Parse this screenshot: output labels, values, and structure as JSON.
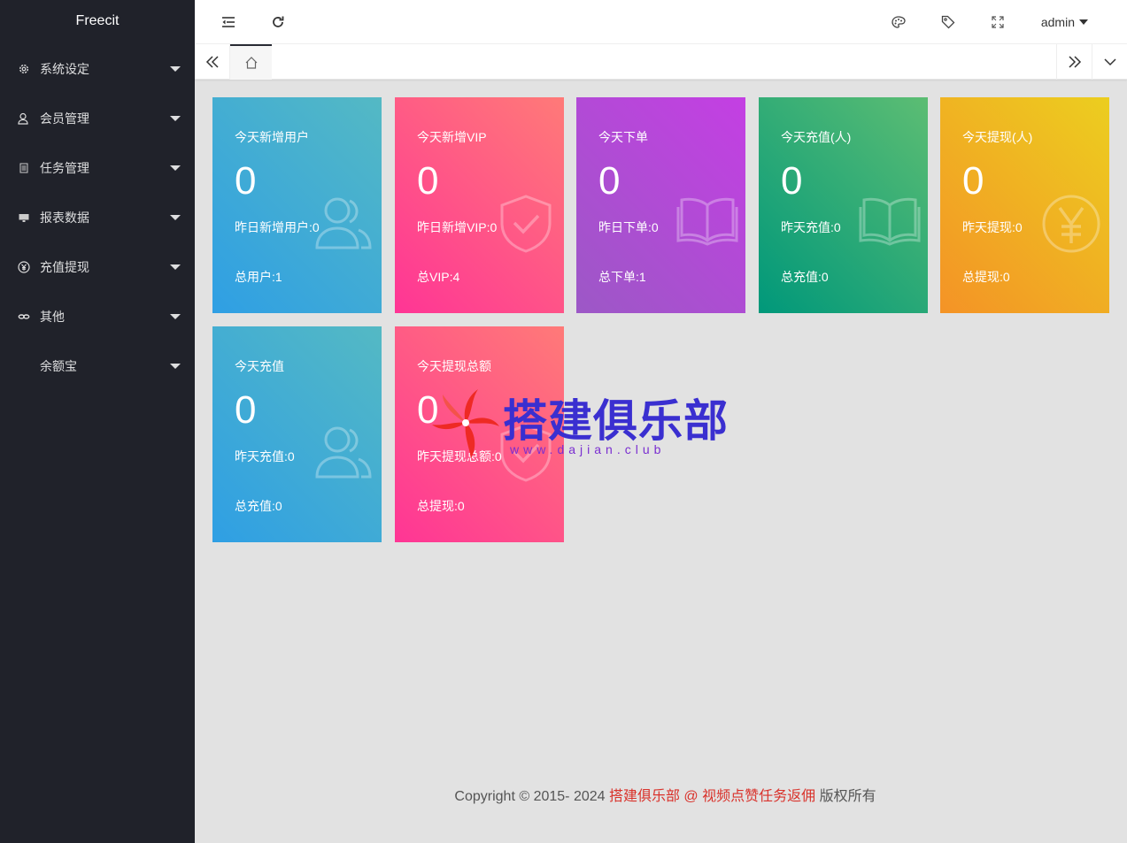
{
  "sidebar": {
    "logo": "Freecit",
    "items": [
      {
        "label": "系统设定",
        "icon": "gear-icon"
      },
      {
        "label": "会员管理",
        "icon": "user-icon"
      },
      {
        "label": "任务管理",
        "icon": "document-icon"
      },
      {
        "label": "报表数据",
        "icon": "screen-icon"
      },
      {
        "label": "充值提现",
        "icon": "yen-icon"
      },
      {
        "label": "其他",
        "icon": "link-icon"
      },
      {
        "label": "余额宝",
        "icon": ""
      }
    ]
  },
  "header": {
    "user": "admin",
    "icons": [
      "menu-fold-icon",
      "refresh-icon",
      "palette-icon",
      "tag-icon",
      "fullscreen-icon"
    ]
  },
  "tabs": {
    "home_icon": "home-icon"
  },
  "cards": [
    {
      "title": "今天新增用户",
      "value": "0",
      "sub1": "昨日新增用户:0",
      "sub2": "总用户:1",
      "icon": "users-icon",
      "color": "blue"
    },
    {
      "title": "今天新增VIP",
      "value": "0",
      "sub1": "昨日新增VIP:0",
      "sub2": "总VIP:4",
      "icon": "shield-check-icon",
      "color": "pink"
    },
    {
      "title": "今天下单",
      "value": "0",
      "sub1": "昨日下单:0",
      "sub2": "总下单:1",
      "icon": "book-icon",
      "color": "purple"
    },
    {
      "title": "今天充值(人)",
      "value": "0",
      "sub1": "昨天充值:0",
      "sub2": "总充值:0",
      "icon": "book-icon",
      "color": "green"
    },
    {
      "title": "今天提现(人)",
      "value": "0",
      "sub1": "昨天提现:0",
      "sub2": "总提现:0",
      "icon": "yen-circle-icon",
      "color": "orange"
    },
    {
      "title": "今天充值",
      "value": "0",
      "sub1": "昨天充值:0",
      "sub2": "总充值:0",
      "icon": "users-icon",
      "color": "blue"
    },
    {
      "title": "今天提现总额",
      "value": "0",
      "sub1": "昨天提现总额:0",
      "sub2": "总提现:0",
      "icon": "shield-check-icon",
      "color": "pink"
    }
  ],
  "watermark": {
    "text": "搭建俱乐部",
    "url": "www.dajian.club"
  },
  "footer": {
    "prefix": "Copyright © 2015- 2024 ",
    "link": "搭建俱乐部 @ 视频点赞任务返佣",
    "suffix": " 版权所有"
  }
}
